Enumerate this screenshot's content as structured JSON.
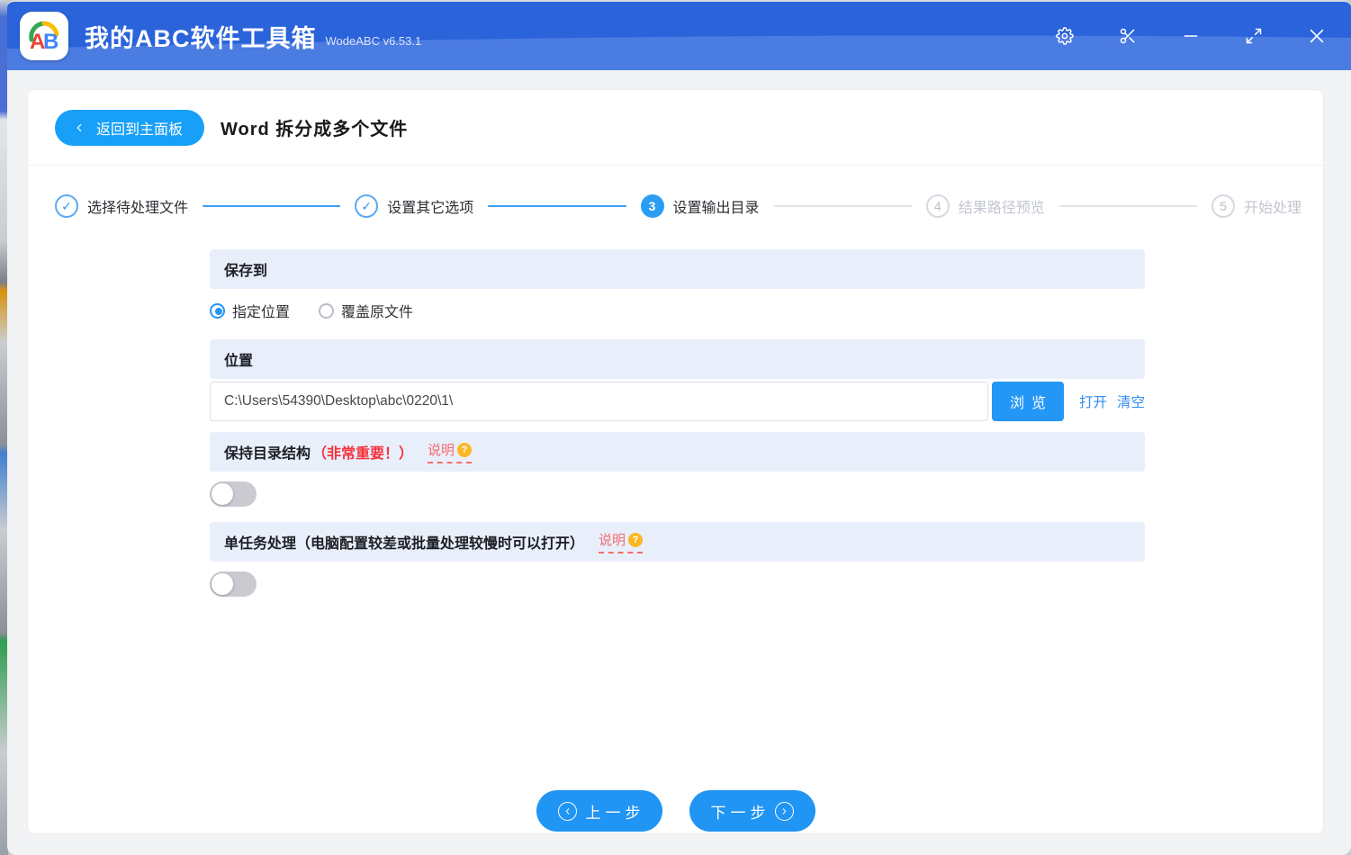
{
  "titlebar": {
    "logo_text": "AB",
    "app_title": "我的ABC软件工具箱",
    "version": "WodeABC v6.53.1"
  },
  "header": {
    "back_label": "返回到主面板",
    "page_title": "Word 拆分成多个文件"
  },
  "stepper": {
    "check_glyph": "✓",
    "steps": [
      {
        "number": "1",
        "label": "选择待处理文件",
        "status": "done"
      },
      {
        "number": "2",
        "label": "设置其它选项",
        "status": "done"
      },
      {
        "number": "3",
        "label": "设置输出目录",
        "status": "active"
      },
      {
        "number": "4",
        "label": "结果路径预览",
        "status": "pending"
      },
      {
        "number": "5",
        "label": "开始处理",
        "status": "pending"
      }
    ]
  },
  "form": {
    "save_to": {
      "header": "保存到",
      "options": [
        {
          "label": "指定位置",
          "selected": true
        },
        {
          "label": "覆盖原文件",
          "selected": false
        }
      ]
    },
    "location": {
      "header": "位置",
      "path_value": "C:\\Users\\54390\\Desktop\\abc\\0220\\1\\",
      "browse_label": "浏览",
      "open_label": "打开",
      "clear_label": "清空"
    },
    "keep_structure": {
      "header": "保持目录结构",
      "important_note": "（非常重要！）",
      "help_label": "说明",
      "help_glyph": "?",
      "enabled": false
    },
    "single_task": {
      "header": "单任务处理（电脑配置较差或批量处理较慢时可以打开）",
      "help_label": "说明",
      "help_glyph": "?",
      "enabled": false
    }
  },
  "footer": {
    "prev_label": "上一步",
    "next_label": "下一步"
  },
  "colors": {
    "titlebar_blue": "#2a63da",
    "titlebar_wave_blue": "#4b7ce2",
    "primary_blue": "#2095f4",
    "back_button_blue": "#18a0f8",
    "browse_button_blue": "#2496f5",
    "section_header_bg": "#e9eefb",
    "alert_red": "#f5323c",
    "help_red": "#f56c6c",
    "help_icon_orange": "#fbb824",
    "step_pending_gray": "#c2c6ce"
  }
}
